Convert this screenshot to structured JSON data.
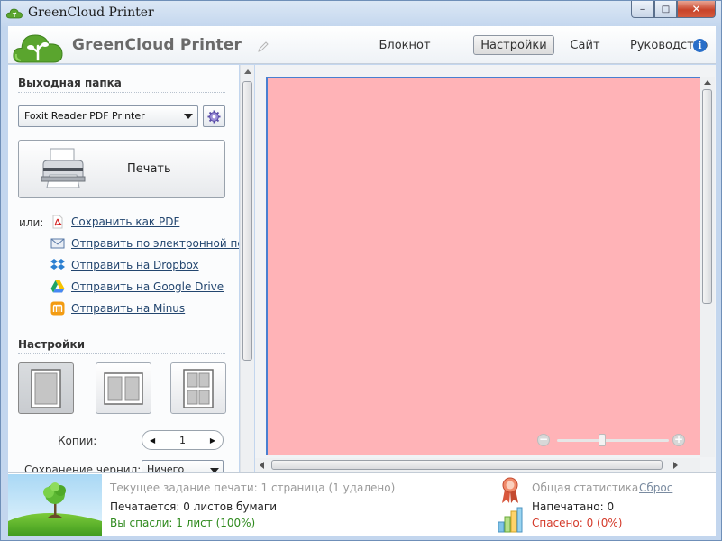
{
  "window": {
    "title": "GreenCloud Printer",
    "min": "‒",
    "max": "□",
    "close": "✕"
  },
  "header": {
    "app_name": "GreenCloud Printer",
    "nav": {
      "notepad": "Блокнот",
      "settings": "Настройки",
      "site": "Сайт",
      "guide": "Руководство"
    },
    "info_glyph": "i"
  },
  "output": {
    "title": "Выходная папка",
    "printer": "Foxit Reader PDF Printer",
    "print_label": "Печать",
    "or_label": "или:",
    "share": [
      {
        "label": "Сохранить как PDF",
        "icon": "pdf-icon"
      },
      {
        "label": "Отправить по электронной почте",
        "icon": "email-icon"
      },
      {
        "label": "Отправить на Dropbox",
        "icon": "dropbox-icon"
      },
      {
        "label": "Отправить на Google Drive",
        "icon": "google-drive-icon"
      },
      {
        "label": "Отправить на Minus",
        "icon": "minus-icon"
      }
    ]
  },
  "settings": {
    "title": "Настройки",
    "copies_label": "Копии:",
    "copies_value": "1",
    "ink_label": "Сохранение чернил:",
    "ink_value": "Ничего"
  },
  "status": {
    "current_job": "Текущее задание печати: 1 страница (1 удалено)",
    "printing": "Печатается: 0 листов бумаги",
    "saved": "Вы спасли: 1 лист (100%)",
    "total_title": "Общая статистика",
    "reset": "Сброс",
    "printed": "Напечатано: 0",
    "saved_total": "Спасено: 0 (0%)"
  },
  "colors": {
    "preview_page": "#ffb3b7",
    "brand_green": "#5aa52e",
    "link": "#23466f",
    "saved_green": "#2f8a1e",
    "saved_red": "#d43a2a"
  }
}
